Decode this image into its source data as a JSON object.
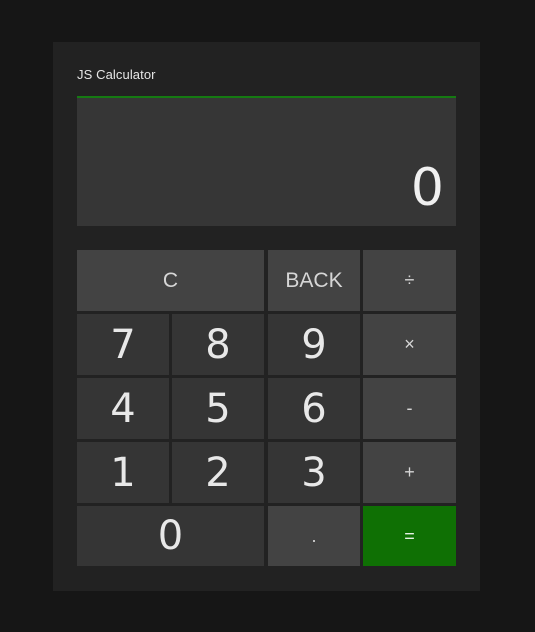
{
  "app": {
    "title": "JS Calculator"
  },
  "display": {
    "value": "0"
  },
  "keys": {
    "clear": "C",
    "back": "BACK",
    "divide": "÷",
    "seven": "7",
    "eight": "8",
    "nine": "9",
    "multiply": "×",
    "four": "4",
    "five": "5",
    "six": "6",
    "subtract": "-",
    "one": "1",
    "two": "2",
    "three": "3",
    "add": "+",
    "zero": "0",
    "decimal": ".",
    "equals": "="
  },
  "colors": {
    "page_background": "#161616",
    "panel_background": "#222222",
    "display_background": "#363636",
    "accent_green": "#157a12",
    "number_key": "#353535",
    "function_key": "#434343",
    "equals_key": "#0f7004"
  }
}
